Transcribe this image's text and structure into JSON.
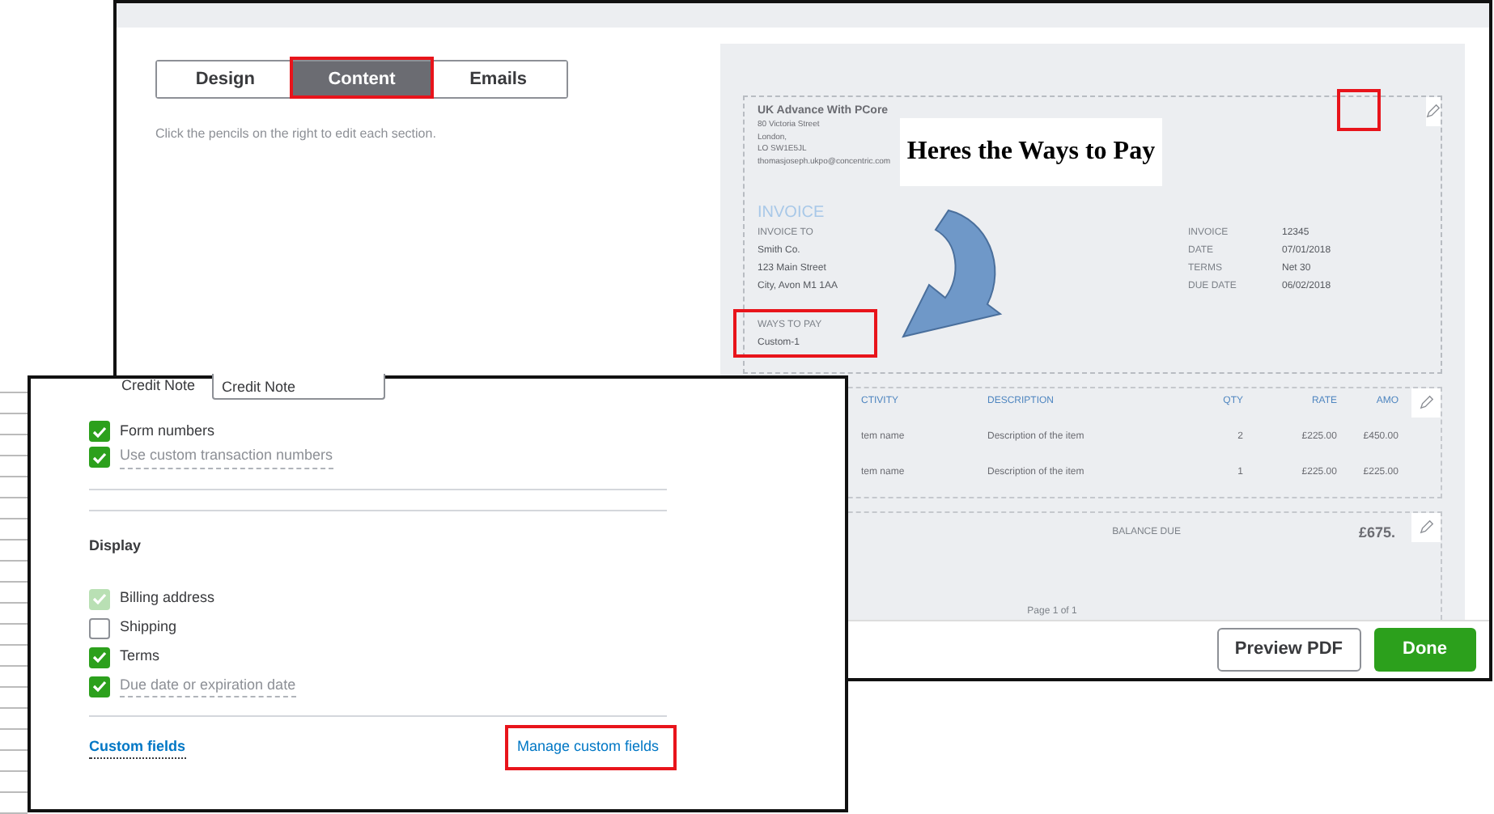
{
  "editor": {
    "tabs": [
      {
        "label": "Design",
        "selected": false
      },
      {
        "label": "Content",
        "selected": true
      },
      {
        "label": "Emails",
        "selected": false
      }
    ],
    "hint": "Click the pencils on the right to edit each section.",
    "preview": {
      "company": "UK Advance With PCore",
      "address_lines": [
        "80 Victoria Street",
        "London,",
        "LO SW1E5JL",
        "thomasjoseph.ukpo@concentric.com"
      ],
      "title": "INVOICE",
      "invoice_to_label": "INVOICE TO",
      "invoice_to_lines": [
        "Smith Co.",
        "123 Main Street",
        "City, Avon M1 1AA"
      ],
      "meta": [
        {
          "label": "INVOICE",
          "value": "12345"
        },
        {
          "label": "DATE",
          "value": "07/01/2018"
        },
        {
          "label": "TERMS",
          "value": "Net 30"
        },
        {
          "label": "DUE DATE",
          "value": "06/02/2018"
        }
      ],
      "ways_to_pay_label": "WAYS TO PAY",
      "ways_to_pay_value": "Custom-1",
      "columns": [
        "CTIVITY",
        "DESCRIPTION",
        "QTY",
        "RATE",
        "AMO"
      ],
      "rows": [
        [
          "tem name",
          "Description of the item",
          "2",
          "£225.00",
          "£450.00"
        ],
        [
          "tem name",
          "Description of the item",
          "1",
          "£225.00",
          "£225.00"
        ]
      ],
      "balance_due_label": "BALANCE DUE",
      "balance_due_value": "£675.",
      "page_label": "Page 1 of 1"
    },
    "buttons": [
      {
        "label": "Preview PDF",
        "kind": "secondary"
      },
      {
        "label": "Done",
        "kind": "primary"
      }
    ]
  },
  "callout": "Heres the Ways to Pay",
  "content_panel": {
    "credit_note_label": "Credit Note",
    "credit_note_value": "Credit Note",
    "numbering": [
      {
        "label": "Form numbers",
        "checked": true,
        "disabled": false,
        "tooltip": false
      },
      {
        "label": "Use custom transaction numbers",
        "checked": true,
        "disabled": false,
        "tooltip": true
      }
    ],
    "display_title": "Display",
    "display": [
      {
        "label": "Billing address",
        "checked": true,
        "disabled": true,
        "tooltip": false
      },
      {
        "label": "Shipping",
        "checked": false,
        "disabled": false,
        "tooltip": false
      },
      {
        "label": "Terms",
        "checked": true,
        "disabled": false,
        "tooltip": false
      },
      {
        "label": "Due date or expiration date",
        "checked": true,
        "disabled": false,
        "tooltip": true
      }
    ],
    "custom_fields_label": "Custom fields",
    "manage_link": "Manage custom fields"
  }
}
